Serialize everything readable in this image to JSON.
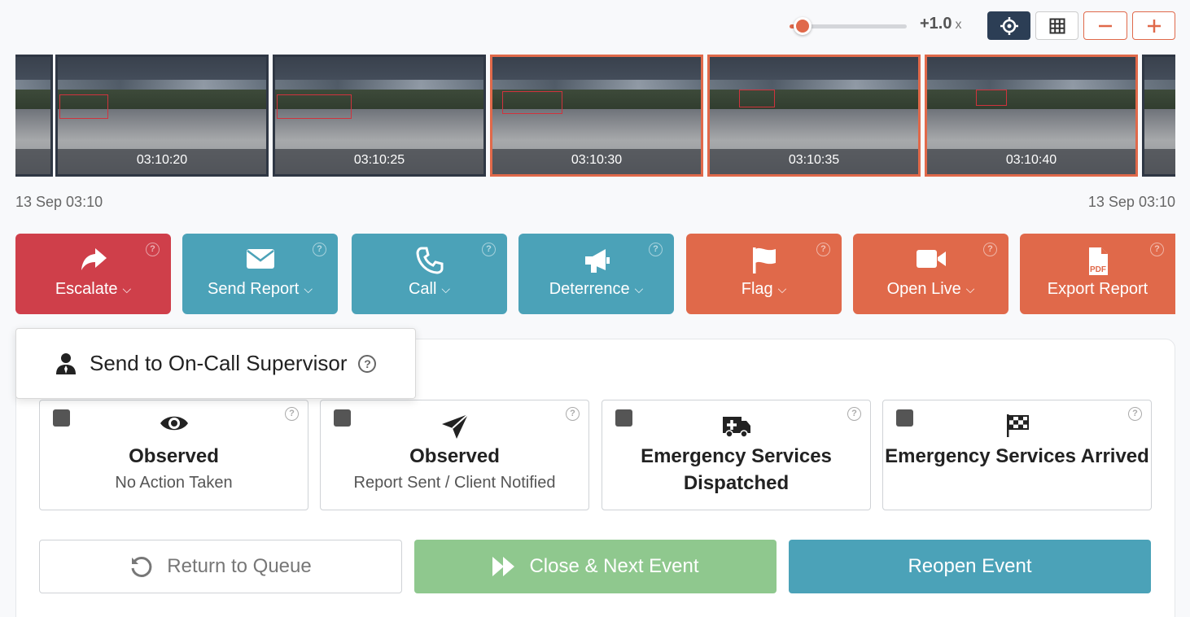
{
  "toolbar": {
    "zoom_value": "+1.0",
    "zoom_unit": "x",
    "zoom_slider_level": 0.02,
    "icons": [
      "crosshair-icon",
      "grid-icon",
      "minus-icon",
      "plus-icon"
    ]
  },
  "timeline": {
    "thumbnails": [
      {
        "time": ""
      },
      {
        "time": "03:10:20"
      },
      {
        "time": "03:10:25"
      },
      {
        "time": "03:10:30",
        "selected": true
      },
      {
        "time": "03:10:35",
        "highlight": true
      },
      {
        "time": "03:10:40",
        "highlight": true
      },
      {
        "time": ""
      }
    ],
    "start_label": "13 Sep 03:10",
    "end_label": "13 Sep 03:10"
  },
  "actions": [
    {
      "label": "Escalate",
      "icon": "share-arrow-icon",
      "color": "#cf3f4a",
      "dropdown": true
    },
    {
      "label": "Send Report",
      "icon": "envelope-icon",
      "color": "#4ba2b8",
      "dropdown": true
    },
    {
      "label": "Call",
      "icon": "phone-icon",
      "color": "#4ba2b8",
      "dropdown": true
    },
    {
      "label": "Deterrence",
      "icon": "megaphone-icon",
      "color": "#4ba2b8",
      "dropdown": true
    },
    {
      "label": "Flag",
      "icon": "flag-icon",
      "color": "#e0694a",
      "dropdown": true
    },
    {
      "label": "Open Live",
      "icon": "video-camera-icon",
      "color": "#e0694a",
      "dropdown": true
    },
    {
      "label": "Export Report",
      "icon": "pdf-file-icon",
      "color": "#e0694a",
      "dropdown": false
    }
  ],
  "escalate_menu": {
    "item": "Send to On-Call Supervisor"
  },
  "outcomes": [
    {
      "title": "Observed",
      "subtitle": "No Action Taken",
      "icon": "eye-icon"
    },
    {
      "title": "Observed",
      "subtitle": "Report Sent / Client Notified",
      "icon": "paper-plane-icon"
    },
    {
      "title": "Emergency Services Dispatched",
      "subtitle": "",
      "icon": "ambulance-icon"
    },
    {
      "title": "Emergency Services Arrived",
      "subtitle": "",
      "icon": "checkered-flag-icon"
    }
  ],
  "bottom": {
    "return_label": "Return to Queue",
    "close_next_label": "Close & Next Event",
    "reopen_label": "Reopen Event"
  },
  "colors": {
    "accent_orange": "#e0694a",
    "teal": "#4ba2b8",
    "red": "#cf3f4a",
    "green": "#8fc88e",
    "navy": "#2c3e55"
  }
}
